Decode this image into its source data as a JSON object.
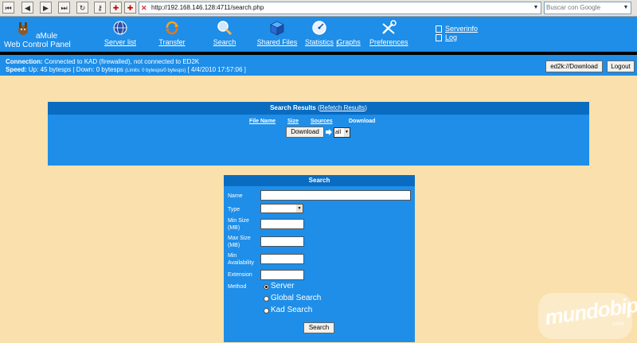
{
  "browser": {
    "url": "http://192.168.146.128:4711/search.php",
    "search_placeholder": "Buscar con Google"
  },
  "header": {
    "logo_line1": "aMule",
    "logo_line2": "Web Control Panel",
    "nav": [
      {
        "label": "Server list",
        "icon": "globe-icon"
      },
      {
        "label": "Transfer",
        "icon": "transfer-icon"
      },
      {
        "label": "Search",
        "icon": "magnifier-icon"
      },
      {
        "label": "Shared Files",
        "icon": "box-icon"
      },
      {
        "label": "Statistics",
        "icon": "gauge-icon"
      },
      {
        "label": "Graphs",
        "icon": ""
      },
      {
        "label": "Preferences",
        "icon": "tools-icon"
      }
    ],
    "separator": "|",
    "side_links": [
      "Serverinfo",
      "Log"
    ]
  },
  "status": {
    "connection_label": "Connection:",
    "connection_text": "Connected to KAD (firewalled), not connected to ED2K",
    "speed_label": "Speed:",
    "speed_text": "Up: 45 bytesps | Down: 0 bytesps",
    "limits_text": "(Limits: 0 bytesps/0 bytesps)",
    "datetime": "[ 4/4/2010 17:57:06 ]",
    "ed2k_button": "ed2k://Download",
    "logout_button": "Logout"
  },
  "results": {
    "title": "Search Results",
    "refetch_open": "(",
    "refetch": "Refetch Results",
    "refetch_close": ")",
    "columns": [
      "File Name",
      "Size",
      "Sources",
      "Download"
    ],
    "download_button": "Download",
    "category_value": "all"
  },
  "search": {
    "title": "Search",
    "name_label": "Name",
    "type_label": "Type",
    "min_size_label": [
      "Min Size",
      "(MB)"
    ],
    "max_size_label": [
      "Max Size",
      "(MB)"
    ],
    "min_avail_label": [
      "Min",
      "Availability"
    ],
    "extension_label": "Extension",
    "method_label": "Method",
    "methods": [
      "Server",
      "Global Search",
      "Kad Search"
    ],
    "selected_method": "Server",
    "button": "Search"
  },
  "watermark": {
    "text": "mundobip",
    "suffix": ".com"
  }
}
